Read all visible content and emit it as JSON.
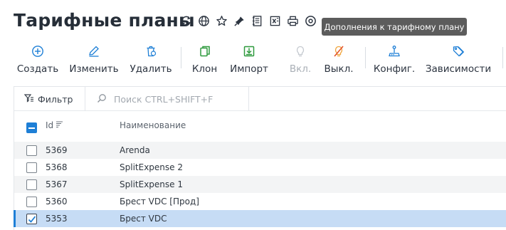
{
  "page": {
    "title": "Тарифные планы"
  },
  "title_icons": [
    {
      "name": "refresh-icon"
    },
    {
      "name": "globe-icon"
    },
    {
      "name": "star-icon"
    },
    {
      "name": "pin-icon"
    },
    {
      "name": "notes-icon"
    },
    {
      "name": "export-excel-icon"
    },
    {
      "name": "print-icon"
    },
    {
      "name": "help-icon"
    }
  ],
  "tooltip": {
    "text": "Дополнения к тарифному плану"
  },
  "toolbar": {
    "create": "Создать",
    "edit": "Изменить",
    "delete": "Удалить",
    "clone": "Клон",
    "import": "Импорт",
    "enable": "Вкл.",
    "disable": "Выкл.",
    "config": "Конфиг.",
    "dependencies": "Зависимости"
  },
  "colors": {
    "accent_blue": "#1e7fd6",
    "green": "#2f9a3e",
    "red": "#e3522b",
    "orange": "#f0a43a",
    "selected_row": "#c6dcf5"
  },
  "filter": {
    "label": "Фильтр",
    "search_placeholder": "Поиск CTRL+SHIFT+F"
  },
  "table": {
    "columns": {
      "id": "Id",
      "name": "Наименование"
    },
    "rows": [
      {
        "id": "5369",
        "name": "Arenda",
        "checked": false
      },
      {
        "id": "5368",
        "name": "SplitExpense 2",
        "checked": false
      },
      {
        "id": "5367",
        "name": "SplitExpense 1",
        "checked": false
      },
      {
        "id": "5360",
        "name": "Брест VDC [Прод]",
        "checked": false
      },
      {
        "id": "5353",
        "name": "Брест VDC",
        "checked": true
      }
    ]
  }
}
